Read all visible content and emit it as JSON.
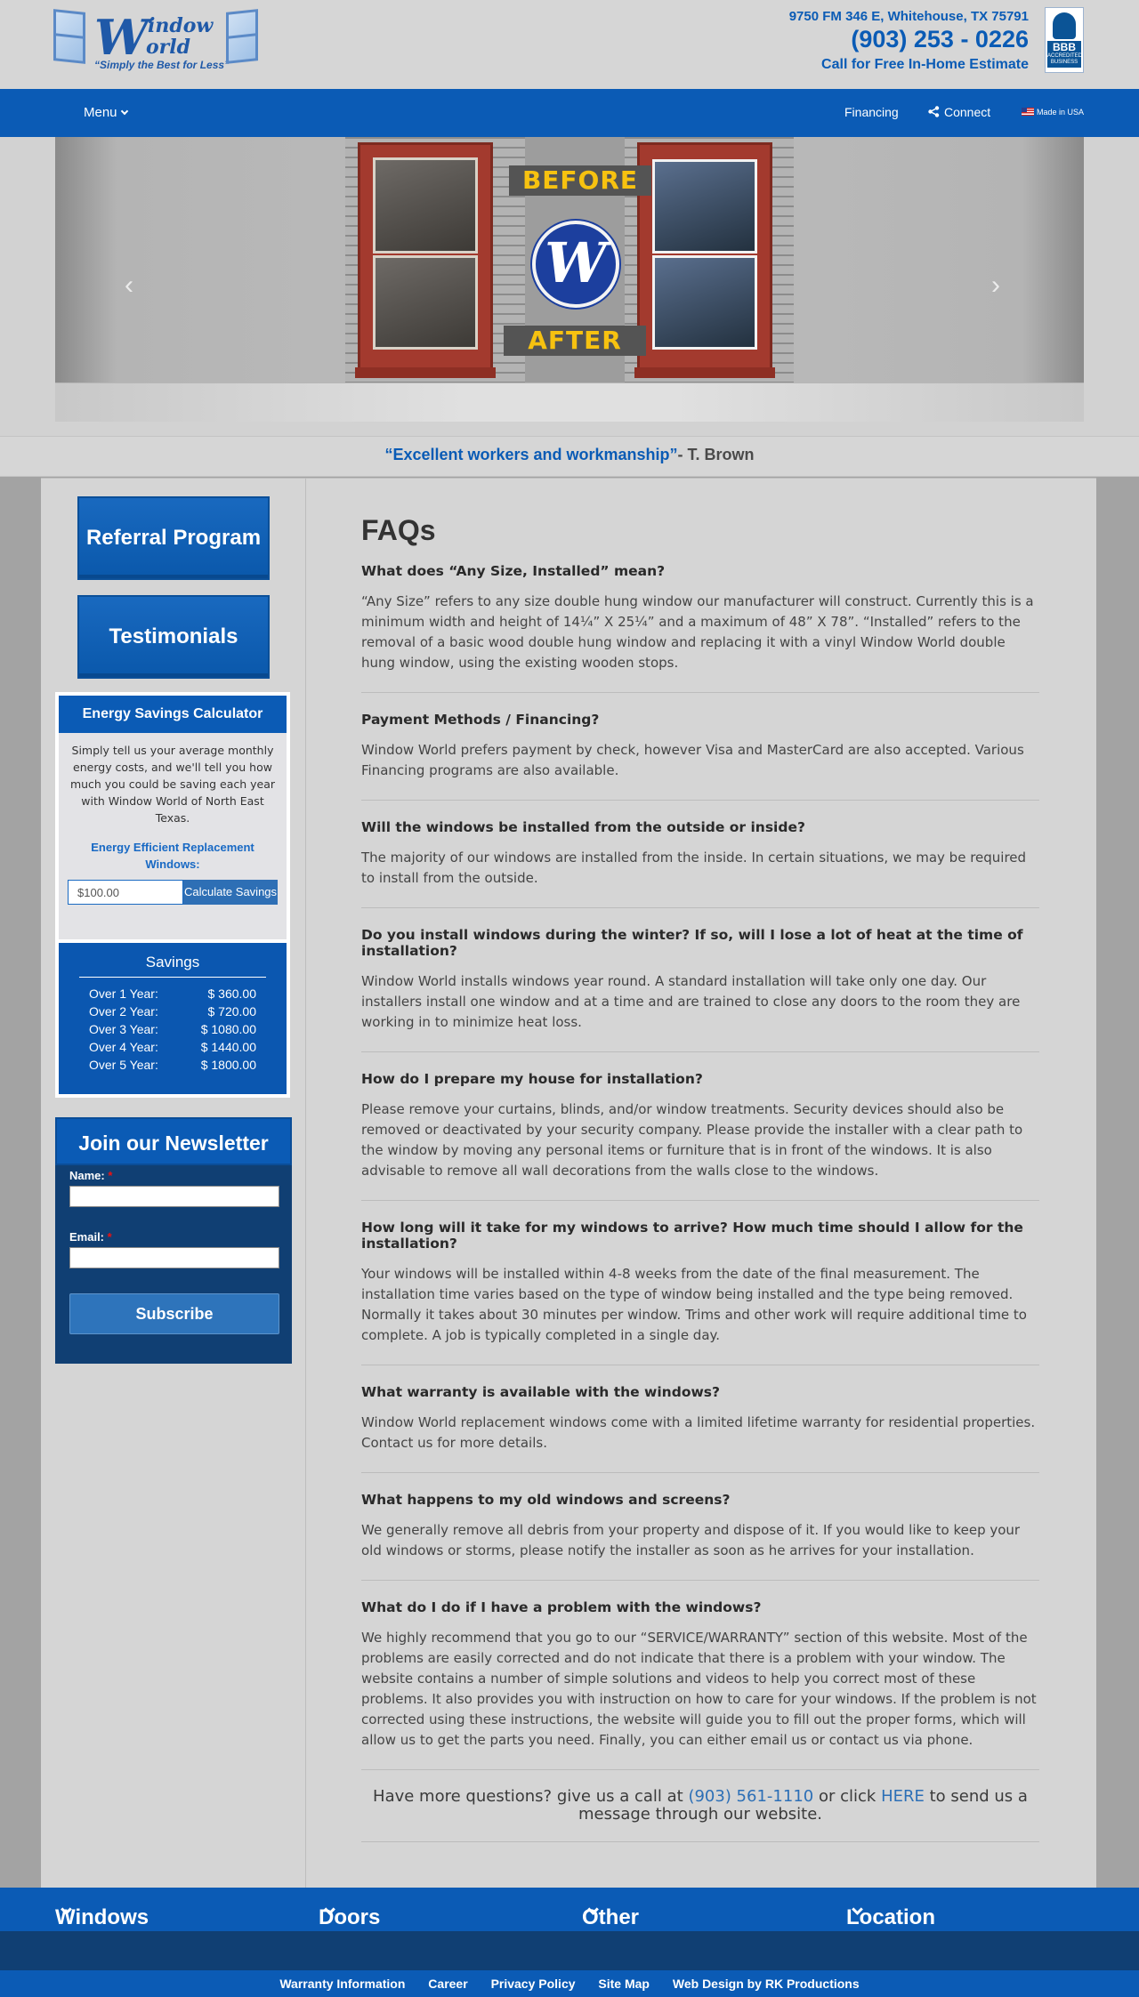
{
  "header": {
    "logo": {
      "word1": "W",
      "word2": "indow",
      "word3": "orld",
      "tagline": "“Simply the Best for Less”"
    },
    "address": "9750 FM 346 E, Whitehouse, TX 75791",
    "phone": "(903) 253 - 0226",
    "cta": "Call for Free In-Home Estimate",
    "bbb": {
      "title": "BBB",
      "sub": "ACCREDITED BUSINESS"
    }
  },
  "nav": {
    "menu": "Menu",
    "financing": "Financing",
    "connect": "Connect",
    "made_in_usa": "Made in USA"
  },
  "slider": {
    "before": "BEFORE",
    "after": "AFTER",
    "logo_letter": "W",
    "prev": "‹",
    "next": "›"
  },
  "testimonial": {
    "quote": "“Excellent workers and workmanship”",
    "author": "- T. Brown"
  },
  "sidebar": {
    "referral": "Referral Program",
    "testimonials": "Testimonials",
    "calculator": {
      "title": "Energy Savings Calculator",
      "description": "Simply tell us your average monthly energy costs, and we'll tell you how much you could be saving each year with Window World of North East Texas.",
      "subtitle": "Energy Efficient Replacement Windows:",
      "input_value": "$100.00",
      "button": "Calculate Savings",
      "savings_title": "Savings",
      "rows": [
        {
          "label": "Over 1 Year:",
          "value": "$ 360.00"
        },
        {
          "label": "Over 2 Year:",
          "value": "$ 720.00"
        },
        {
          "label": "Over 3 Year:",
          "value": "$ 1080.00"
        },
        {
          "label": "Over 4 Year:",
          "value": "$ 1440.00"
        },
        {
          "label": "Over 5 Year:",
          "value": "$ 1800.00"
        }
      ]
    },
    "newsletter": {
      "title": "Join our Newsletter",
      "name_label": "Name:",
      "email_label": "Email:",
      "required": "*",
      "button": "Subscribe"
    }
  },
  "content": {
    "title": "FAQs",
    "faqs": [
      {
        "q": "What does “Any Size, Installed” mean?",
        "a": "“Any Size” refers to any size double hung window our manufacturer will construct. Currently this is a minimum width and height of 14¼” X 25¼” and a maximum of 48” X 78”. “Installed” refers to the removal of a basic wood double hung window and replacing it with a vinyl Window World double hung window, using the existing wooden stops."
      },
      {
        "q": "Payment Methods / Financing?",
        "a": "Window World prefers payment by check, however Visa and MasterCard are also accepted. Various Financing programs are also available."
      },
      {
        "q": "Will the windows be installed from the outside or inside?",
        "a": "The majority of our windows are installed from the inside. In certain situations, we may be required to install from the outside."
      },
      {
        "q": "Do you install windows during the winter? If so, will I lose a lot of heat at the time of installation?",
        "a": "Window World installs windows year round. A standard installation will take only one day. Our installers install one window and at a time and are trained to close any doors to the room they are working in to minimize heat loss."
      },
      {
        "q": "How do I prepare my house for installation?",
        "a": "Please remove your curtains, blinds, and/or window treatments. Security devices should also be removed or deactivated by your security company. Please provide the installer with a clear path to the window by moving any personal items or furniture that is in front of the windows. It is also advisable to remove all wall decorations from the walls close to the windows."
      },
      {
        "q": "How long will it take for my windows to arrive? How much time should I allow for the installation?",
        "a": "Your windows will be installed within 4-8 weeks from the date of the final measurement. The installation time varies based on the type of window being installed and the type being removed. Normally it takes about 30 minutes per window. Trims and other work will require additional time to complete. A job is typically completed in a single day."
      },
      {
        "q": "What warranty is available with the windows?",
        "a": "Window World replacement windows come with a limited lifetime warranty for residential properties. Contact us for more details."
      },
      {
        "q": "What happens to my old windows and screens?",
        "a": "We generally remove all debris from your property and dispose of it. If you would like to keep your old windows or storms, please notify the installer as soon as he arrives for your installation."
      },
      {
        "q": "What do I do if I have a problem with the windows?",
        "a": "We highly recommend that you go to our “SERVICE/WARRANTY” section of this website. Most of the problems are easily corrected and do not indicate that there is a problem with your window. The website contains a number of simple solutions and videos to help you correct most of these problems. It also provides you with instruction on how to care for your windows. If the problem is not corrected using these instructions, the website will guide you to fill out the proper forms, which will allow us to get the parts you need. Finally, you can either email us or contact us via phone."
      }
    ],
    "ask_prefix": "Have more questions? give us a call at",
    "ask_phone": "(903) 561-1110",
    "ask_mid": "or click",
    "ask_link": "HERE",
    "ask_suffix": "to send us a message through our website."
  },
  "footer": {
    "nav": [
      "Windows",
      "Doors",
      "Other",
      "Location"
    ],
    "links": [
      "Warranty Information",
      "Career",
      "Privacy Policy",
      "Site Map",
      "Web Design by RK Productions"
    ]
  },
  "colors": {
    "brand_blue": "#0b5bb5",
    "dark_blue": "#103f73",
    "gold": "#f7c210"
  }
}
